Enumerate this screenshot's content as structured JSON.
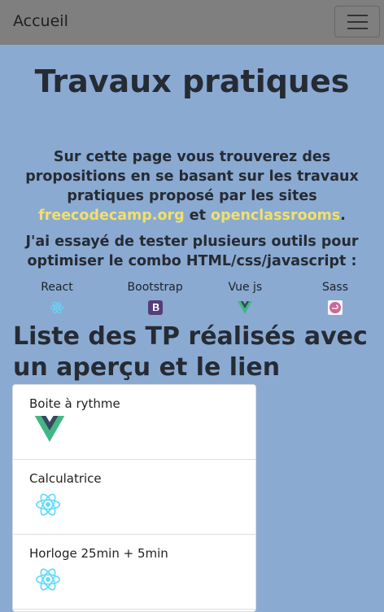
{
  "navbar": {
    "brand": "Accueil",
    "menu_icon": "hamburger-icon"
  },
  "main": {
    "title": "Travaux pratiques",
    "intro_text_1": "Sur cette page vous trouverez des propositions en se basant sur les travaux pratiques proposé par les sites ",
    "link_1": "freecodecamp.org",
    "intro_text_2": " et ",
    "link_2": "openclassrooms",
    "intro_text_3": ".",
    "tools_intro": "J'ai essayé de tester plusieurs outils pour optimiser le combo HTML/css/javascript :",
    "tools": [
      {
        "label": "React",
        "icon": "react-icon"
      },
      {
        "label": "Bootstrap",
        "icon": "bootstrap-icon"
      },
      {
        "label": "Vue js",
        "icon": "vue-icon"
      },
      {
        "label": "Sass",
        "icon": "sass-icon"
      }
    ],
    "list_title": "Liste des TP réalisés avec un aperçu et le lien"
  },
  "projects": [
    {
      "label": "Boite à rythme",
      "icon": "vue-icon"
    },
    {
      "label": "Calculatrice",
      "icon": "react-icon"
    },
    {
      "label": "Horloge 25min + 5min",
      "icon": "react-icon"
    }
  ],
  "colors": {
    "background": "#8aaad2",
    "link": "#f1e06b",
    "navbar": "#7f7f7f"
  }
}
